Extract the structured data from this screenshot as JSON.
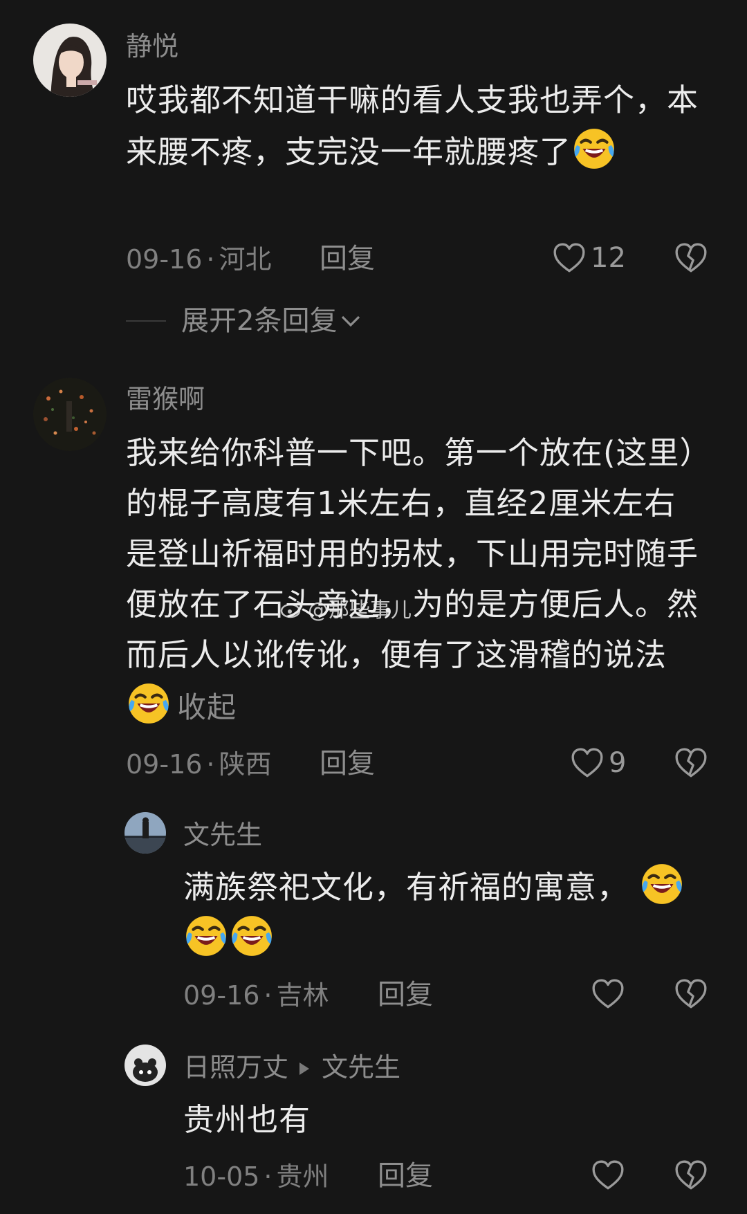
{
  "comments": [
    {
      "user": "静悦",
      "text": "哎我都不知道干嘛的看人支我也弄个，本来腰不疼，支完没一年就腰疼了",
      "date": "09-16",
      "location": "河北",
      "reply_label": "回复",
      "likes": "12",
      "expand_label": "展开2条回复"
    },
    {
      "user": "雷猴啊",
      "text": "我来给你科普一下吧。第一个放在(这里）的棍子高度有1米左右，直经2厘米左右是登山祈福时用的拐杖，下山用完时随手便放在了石头旁边，为的是方便后人。然而后人以讹传讹，便有了这滑稽的说法",
      "collapse_label": "收起",
      "date": "09-16",
      "location": "陕西",
      "reply_label": "回复",
      "likes": "9"
    }
  ],
  "replies": [
    {
      "user": "文先生",
      "text": "满族祭祀文化，有祈福的寓意，",
      "date": "09-16",
      "location": "吉林",
      "reply_label": "回复"
    },
    {
      "user": "日照万丈",
      "reply_to": "文先生",
      "text": "贵州也有",
      "date": "10-05",
      "location": "贵州",
      "reply_label": "回复"
    }
  ],
  "meta_separator": "·",
  "watermark": "@那些事儿",
  "icons": {
    "like": "heart-outline-icon",
    "dislike": "broken-heart-icon",
    "emoji": "crying-laughing-face-emoji",
    "expand": "chevron-down-icon",
    "reply_to": "triangle-right-icon"
  },
  "colors": {
    "background": "#161616",
    "username": "#8d8d8d",
    "body_text": "#ececec",
    "meta": "#808080"
  }
}
